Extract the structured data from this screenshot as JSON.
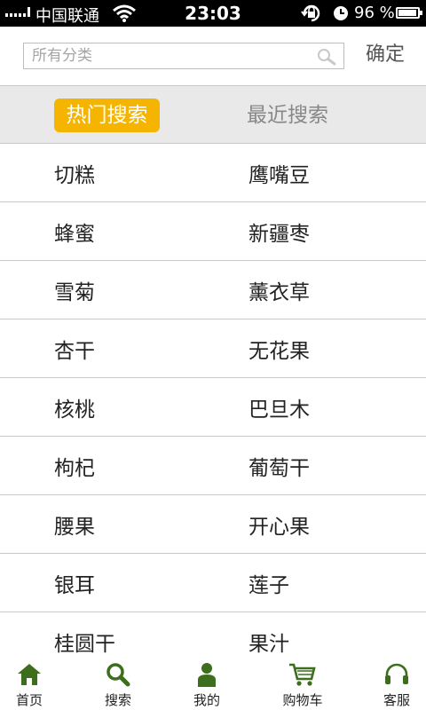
{
  "status_bar": {
    "carrier": "中国联通",
    "time": "23:03",
    "battery": "96 %",
    "battery_level": 0.96
  },
  "search": {
    "placeholder": "所有分类",
    "value": "",
    "confirm_label": "确定"
  },
  "tabs": {
    "hot": "热门搜索",
    "recent": "最近搜索",
    "active": "hot",
    "active_color": "#f5b400"
  },
  "keywords": [
    [
      "切糕",
      "鹰嘴豆"
    ],
    [
      "蜂蜜",
      "新疆枣"
    ],
    [
      "雪菊",
      "薰衣草"
    ],
    [
      "杏干",
      "无花果"
    ],
    [
      "核桃",
      "巴旦木"
    ],
    [
      "枸杞",
      "葡萄干"
    ],
    [
      "腰果",
      "开心果"
    ],
    [
      "银耳",
      "莲子"
    ],
    [
      "桂圆干",
      "果汁"
    ]
  ],
  "bottom_nav": {
    "accent": "#3c6e1e",
    "items": [
      {
        "label": "首页",
        "icon": "home-icon"
      },
      {
        "label": "搜索",
        "icon": "search-icon"
      },
      {
        "label": "我的",
        "icon": "user-icon"
      },
      {
        "label": "购物车",
        "icon": "cart-icon"
      },
      {
        "label": "客服",
        "icon": "headset-icon"
      }
    ]
  }
}
